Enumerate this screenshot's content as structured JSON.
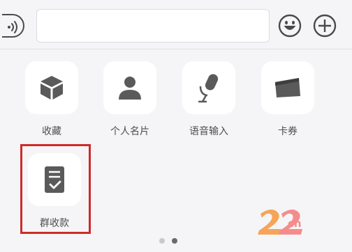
{
  "chat_bar": {
    "input_value": "",
    "icons": [
      "voice-icon",
      "emoji-icon",
      "plus-icon"
    ]
  },
  "tools": [
    {
      "label": "收藏",
      "icon": "cube-icon"
    },
    {
      "label": "个人名片",
      "icon": "person-icon"
    },
    {
      "label": "语音输入",
      "icon": "microphone-icon"
    },
    {
      "label": "卡券",
      "icon": "card-icon"
    },
    {
      "label": "群收款",
      "icon": "group-receipt-icon"
    }
  ],
  "pager": {
    "page_count": 2,
    "current_page": 2
  },
  "highlight_color": "#cf2a2a",
  "watermark": {
    "logo_digits": "22",
    "suffix": "cn",
    "color": "#f58c8c"
  }
}
